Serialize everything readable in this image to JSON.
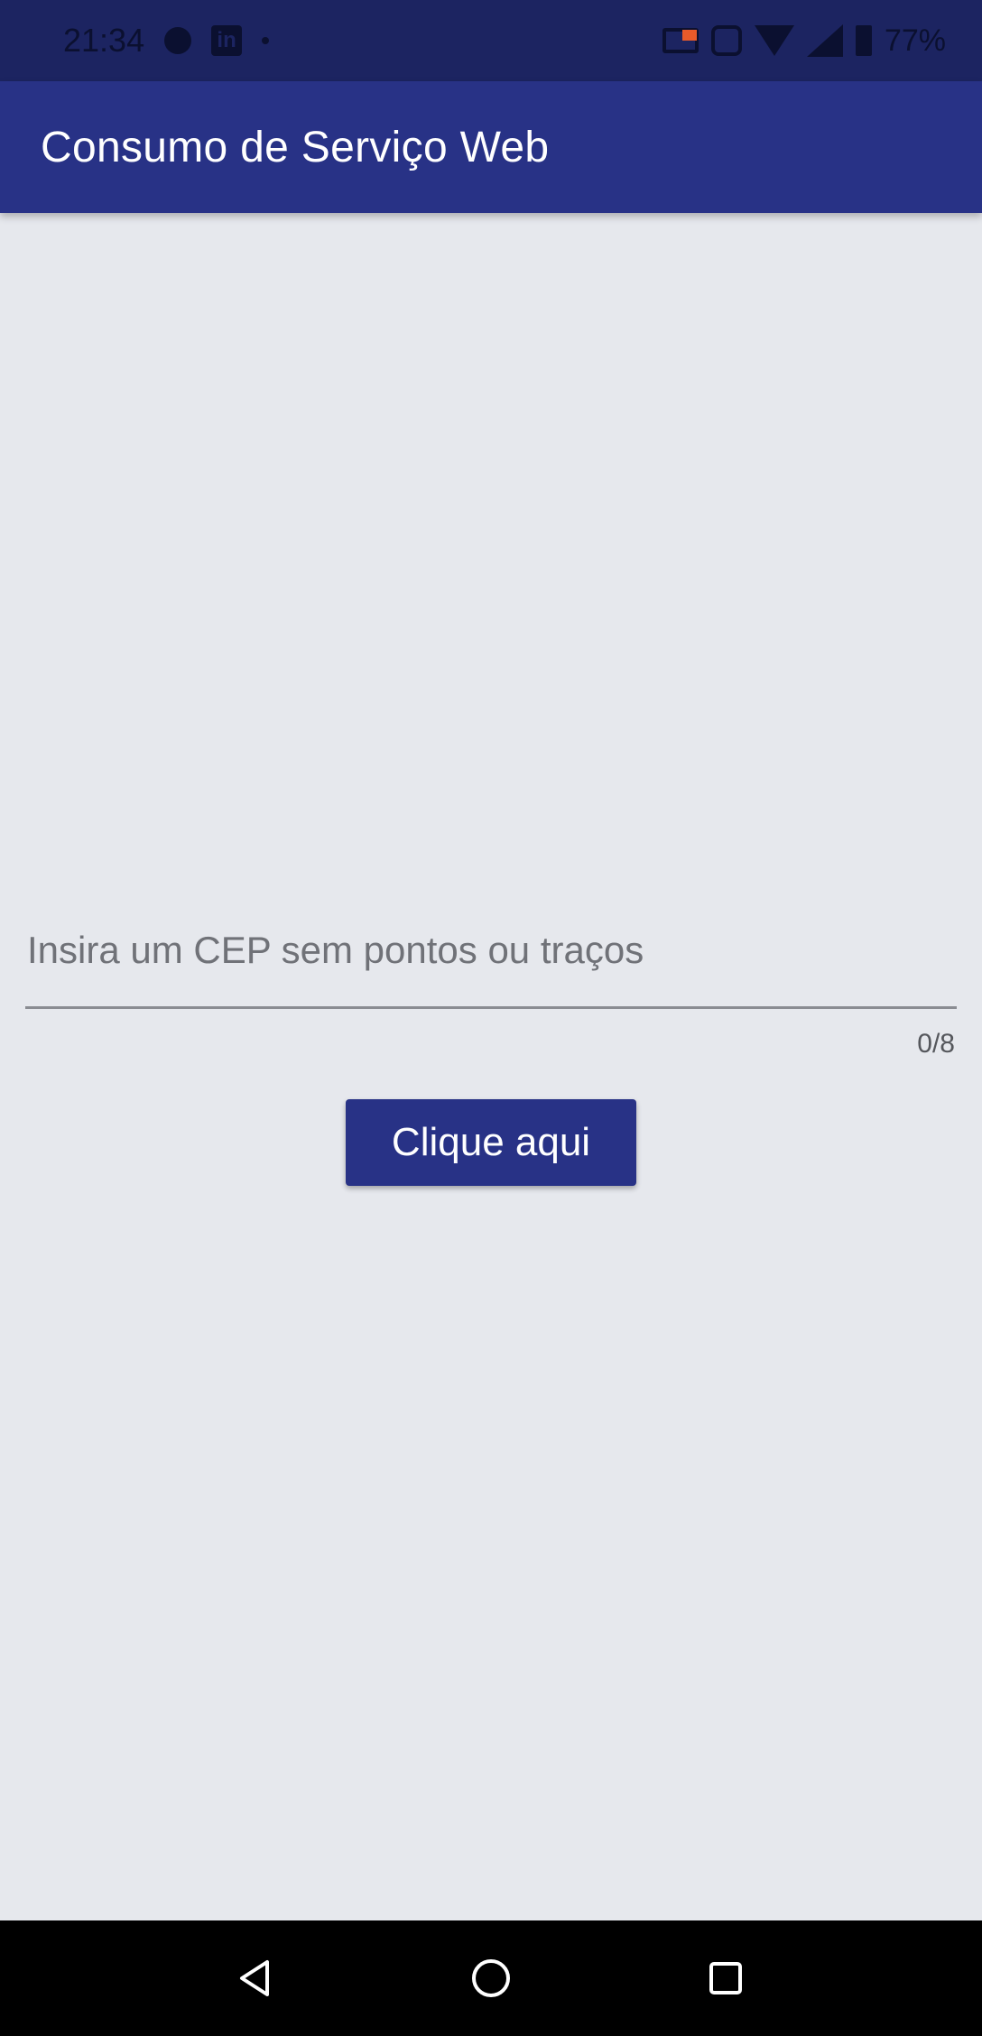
{
  "status_bar": {
    "time": "21:34",
    "battery_percent": "77%",
    "linkedin_glyph": "in",
    "icons": [
      "notification-dot-icon",
      "linkedin-icon",
      "cast-icon",
      "vibrate-icon",
      "wifi-icon",
      "signal-icon",
      "battery-icon"
    ]
  },
  "app_bar": {
    "title": "Consumo de Serviço Web"
  },
  "form": {
    "cep_placeholder": "Insira um CEP sem pontos ou traços",
    "cep_value": "",
    "counter": "0/8",
    "button_label": "Clique aqui"
  },
  "nav_bar": {
    "icons": [
      "back-icon",
      "home-icon",
      "recents-icon"
    ]
  },
  "colors": {
    "primary": "#283286",
    "status_bar": "#1c2461",
    "background": "#e6e8ed"
  }
}
